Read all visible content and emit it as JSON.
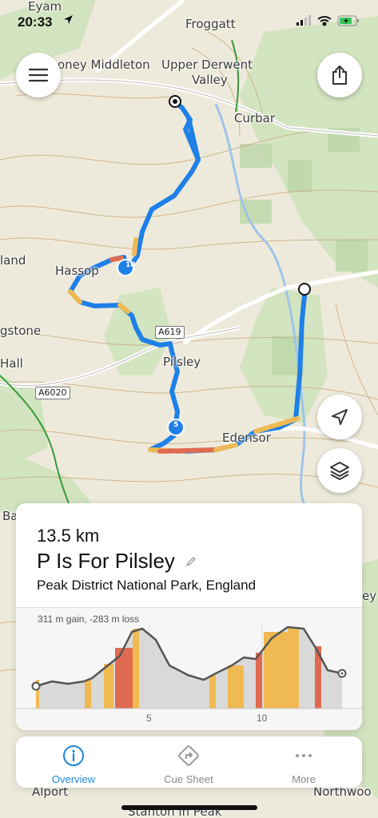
{
  "status_bar": {
    "time": "20:33"
  },
  "map_labels": {
    "eyam": "Eyam",
    "froggatt": "Froggatt",
    "stoney_middleton": "oney Middleton",
    "upper_derwent": "Upper Derwent",
    "valley": "Valley",
    "curbar": "Curbar",
    "land": "land",
    "hassop": "Hassop",
    "gstone": "gstone",
    "hall": "Hall",
    "a619": "A619",
    "pilsley": "Pilsley",
    "a6020": "A6020",
    "edensor": "Edensor",
    "ba": "Ba",
    "ey": "ey",
    "alport": "Alport",
    "stanton": "Stanton in Peak",
    "northwood": "Northwoo"
  },
  "route_markers": {
    "km10": "10",
    "km5": "5"
  },
  "route": {
    "distance": "13.5 km",
    "name": "P Is For Pilsley",
    "location": "Peak District National Park, England"
  },
  "elevation": {
    "summary": "311 m gain, -283 m loss",
    "ticks": [
      "5",
      "10"
    ]
  },
  "tabs": [
    {
      "label": "Overview",
      "icon": "info-icon"
    },
    {
      "label": "Cue Sheet",
      "icon": "turn-sign-icon"
    },
    {
      "label": "More",
      "icon": "more-dots-icon"
    }
  ],
  "colors": {
    "accent": "#1f86d6",
    "route_blue": "#1e80e8",
    "grade_yellow": "#f0ba52",
    "grade_red": "#e06a50"
  }
}
